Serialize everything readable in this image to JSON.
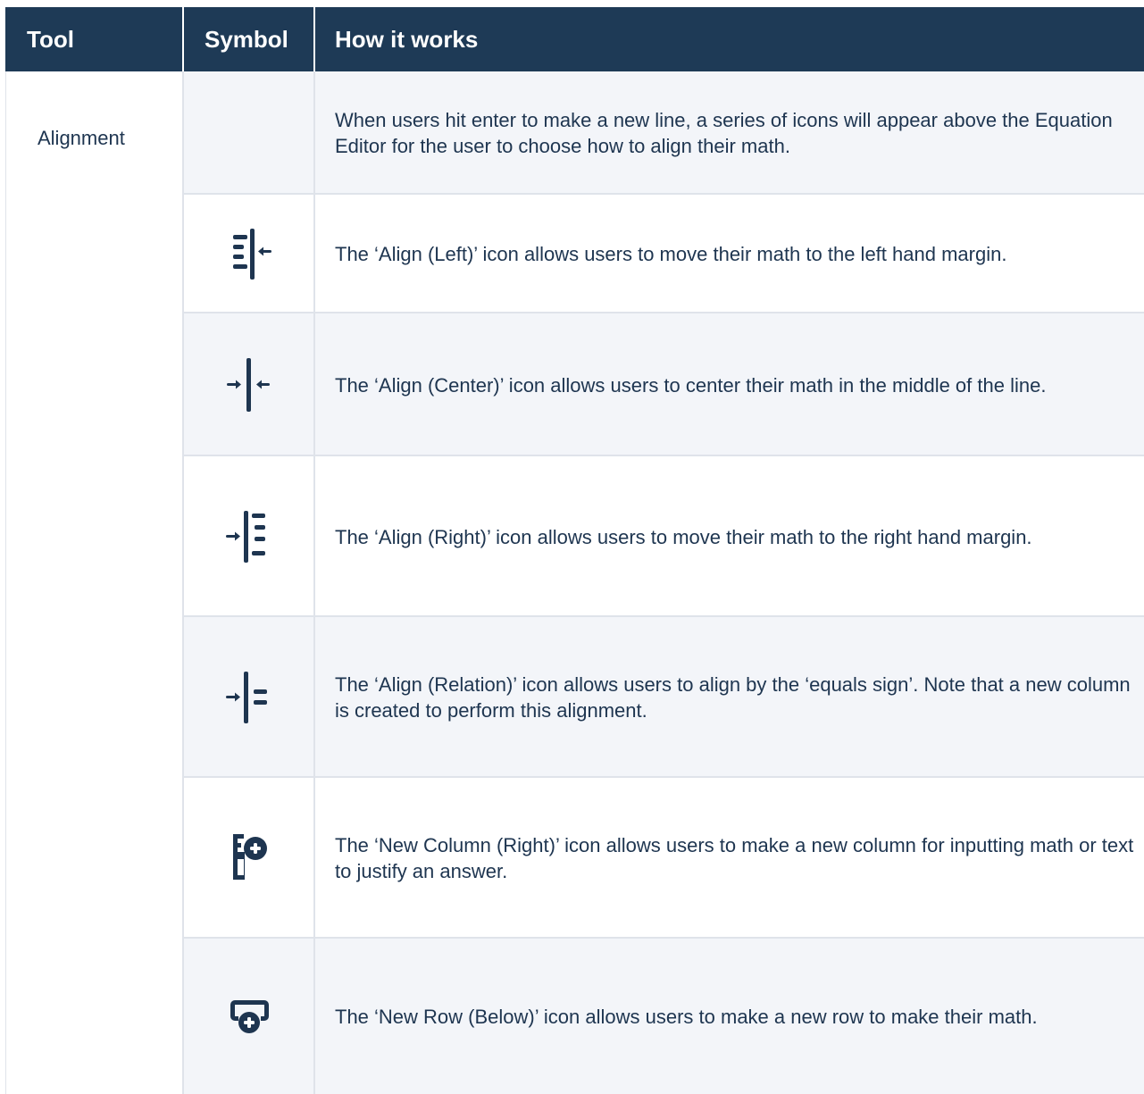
{
  "table": {
    "headers": {
      "tool": "Tool",
      "symbol": "Symbol",
      "how": "How it works"
    },
    "tool_name": "Alignment",
    "rows": [
      {
        "icon": "none",
        "description": "When users hit enter to make a new line, a series of icons will appear above the Equation Editor for the user to choose how to align their math."
      },
      {
        "icon": "align-left-icon",
        "description": "The ‘Align (Left)’ icon allows users to move their math to the left hand margin."
      },
      {
        "icon": "align-center-icon",
        "description": "The ‘Align (Center)’ icon allows users to center their math in the middle of the line."
      },
      {
        "icon": "align-right-icon",
        "description": "The ‘Align (Right)’ icon allows users to move their math to the right hand margin."
      },
      {
        "icon": "align-relation-icon",
        "description": "The ‘Align (Relation)’ icon allows users to align by the ‘equals sign’. Note that a new column is created to perform this alignment."
      },
      {
        "icon": "new-column-right-icon",
        "description": "The ‘New Column (Right)’ icon allows users to make a new column for inputting math or text to justify an answer."
      },
      {
        "icon": "new-row-below-icon",
        "description": "The ‘New Row (Below)’ icon allows users to make a new row to make their math."
      }
    ]
  },
  "colors": {
    "header_bg": "#1e3a56",
    "text": "#1e3550",
    "alt_row": "#f3f5f9",
    "border": "#dfe3ea"
  }
}
